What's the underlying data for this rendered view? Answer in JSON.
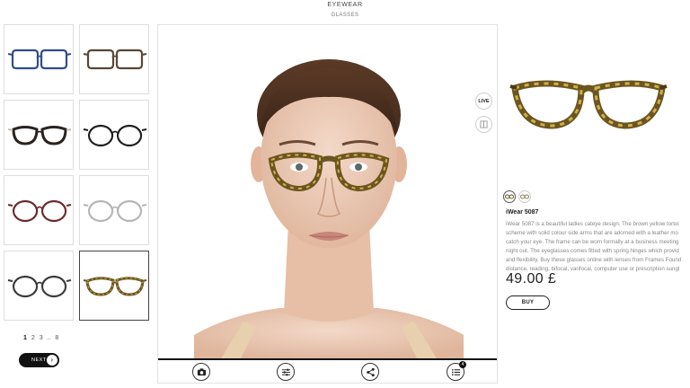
{
  "header": {
    "category": "EYEWEAR",
    "subcategory": "GLASSES"
  },
  "thumbnails": [
    {
      "name": "glasses-blue-rectangle",
      "frame": "#2f4c8c",
      "temple": "#2f4c8c",
      "style": "rect"
    },
    {
      "name": "glasses-brown-rectangle",
      "frame": "#5a4632",
      "temple": "#5a4632",
      "style": "rect"
    },
    {
      "name": "glasses-browline",
      "frame": "#2a2320",
      "temple": "#c9c2b0",
      "style": "browline"
    },
    {
      "name": "glasses-black-round",
      "frame": "#1f1f1f",
      "temple": "#1f1f1f",
      "style": "round"
    },
    {
      "name": "glasses-burgundy-round",
      "frame": "#6b2a2a",
      "temple": "#6b2a2a",
      "style": "round"
    },
    {
      "name": "glasses-silver-round",
      "frame": "#b5b5b5",
      "temple": "#b5b5b5",
      "style": "round"
    },
    {
      "name": "glasses-grey-round",
      "frame": "#3b3b3b",
      "temple": "#3b3b3b",
      "style": "round"
    },
    {
      "name": "glasses-tortoise-cateye",
      "frame": "#6b5520",
      "temple": "#6b5520",
      "style": "cateye",
      "selected": true
    }
  ],
  "pagination": {
    "pages": [
      "1",
      "2",
      "3",
      "..",
      "8"
    ],
    "current": "1"
  },
  "next_label": "NEXT",
  "viewer": {
    "live_label": "LIVE",
    "tools": [
      "camera-icon",
      "sliders-icon",
      "share-icon",
      "list-icon"
    ],
    "list_badge": "4"
  },
  "product": {
    "name": "iWear 5087",
    "description_lines": [
      "iWear 5087 is a beautiful ladies cateye design. The brown yellow tortoi",
      "scheme with solid colour side arms that are adorned with a leather mo",
      "catch your eye. The frame can be worn formally at a business meeting",
      "night out. The eyeglasses comes fitted with spring hinges which provid",
      "and flexibility. Buy these glasses online with lenses from Frames Found",
      "distance, reading, bifocal, varifocal, computer use or prescription sungl"
    ],
    "price": "49.00 £",
    "buy_label": "BUY",
    "colors": {
      "frame": "#7a5a1a",
      "accent": "#d1b045"
    }
  }
}
